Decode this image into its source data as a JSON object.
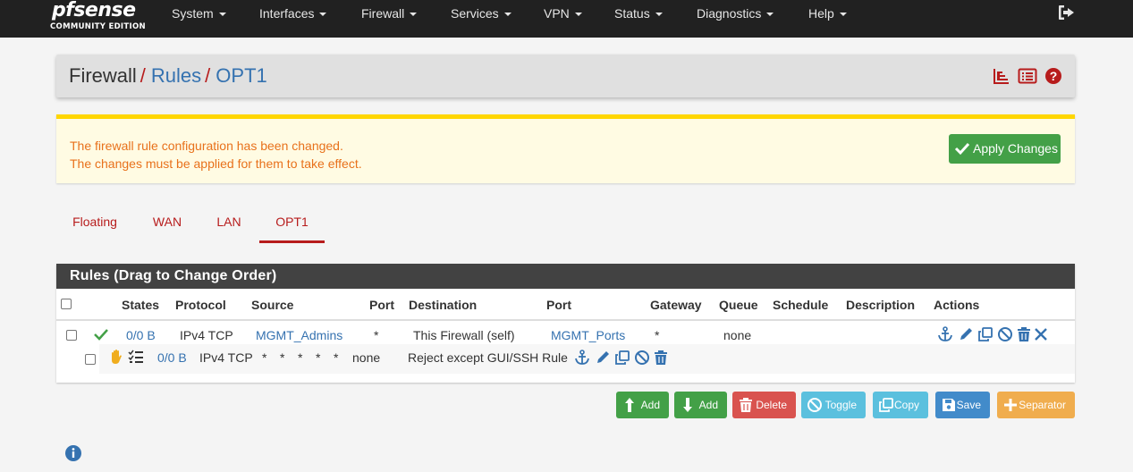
{
  "navbar": {
    "brand_logo": "pfsense",
    "brand_edition": "COMMUNITY EDITION",
    "menu": [
      "System",
      "Interfaces",
      "Firewall",
      "Services",
      "VPN",
      "Status",
      "Diagnostics",
      "Help"
    ],
    "logout_icon": "sign-out-icon"
  },
  "breadcrumb": {
    "root": "Firewall",
    "sep": "/",
    "level2": "Rules",
    "level3": "OPT1",
    "icons": [
      "bar-chart-icon",
      "list-icon",
      "question-circle-icon"
    ]
  },
  "alert": {
    "line1": "The firewall rule configuration has been changed.",
    "line2": "The changes must be applied for them to take effect.",
    "apply_label": "Apply Changes"
  },
  "tabs": [
    {
      "label": "Floating",
      "active": false
    },
    {
      "label": "WAN",
      "active": false
    },
    {
      "label": "LAN",
      "active": false
    },
    {
      "label": "OPT1",
      "active": true
    }
  ],
  "rules": {
    "heading": "Rules (Drag to Change Order)",
    "columns": [
      "States",
      "Protocol",
      "Source",
      "Port",
      "Destination",
      "Port",
      "Gateway",
      "Queue",
      "Schedule",
      "Description",
      "Actions"
    ],
    "rows": [
      {
        "status_icon": "check-icon",
        "states": "0/0 B",
        "protocol": "IPv4 TCP",
        "source": "MGMT_Admins",
        "source_port": "*",
        "destination": "This Firewall (self)",
        "dest_port": "MGMT_Ports",
        "gateway": "*",
        "queue": "none",
        "schedule": "",
        "description": ""
      },
      {
        "status_icon": "hand-stop-icon",
        "log_icon": "tasks-icon",
        "states": "0/0 B",
        "protocol": "IPv4 TCP",
        "source": "*",
        "source_port": "*",
        "destination": "*",
        "dest_port": "*",
        "gateway": "*",
        "queue": "none",
        "schedule": "",
        "description": "Reject except GUI/SSH Rule"
      }
    ]
  },
  "buttons": {
    "add_top": "Add",
    "add_bottom": "Add",
    "delete": "Delete",
    "toggle": "Toggle",
    "copy": "Copy",
    "save": "Save",
    "separator": "Separator"
  },
  "colors": {
    "navbar_bg": "#212121",
    "brand_red": "#b71c1c",
    "link_blue": "#3572b0",
    "alert_text": "#e8711b",
    "alert_border": "#ffd600",
    "success": "#43a047",
    "danger": "#d9534f",
    "info": "#5bc0de",
    "primary": "#428bca",
    "warning": "#f0ad4e"
  }
}
